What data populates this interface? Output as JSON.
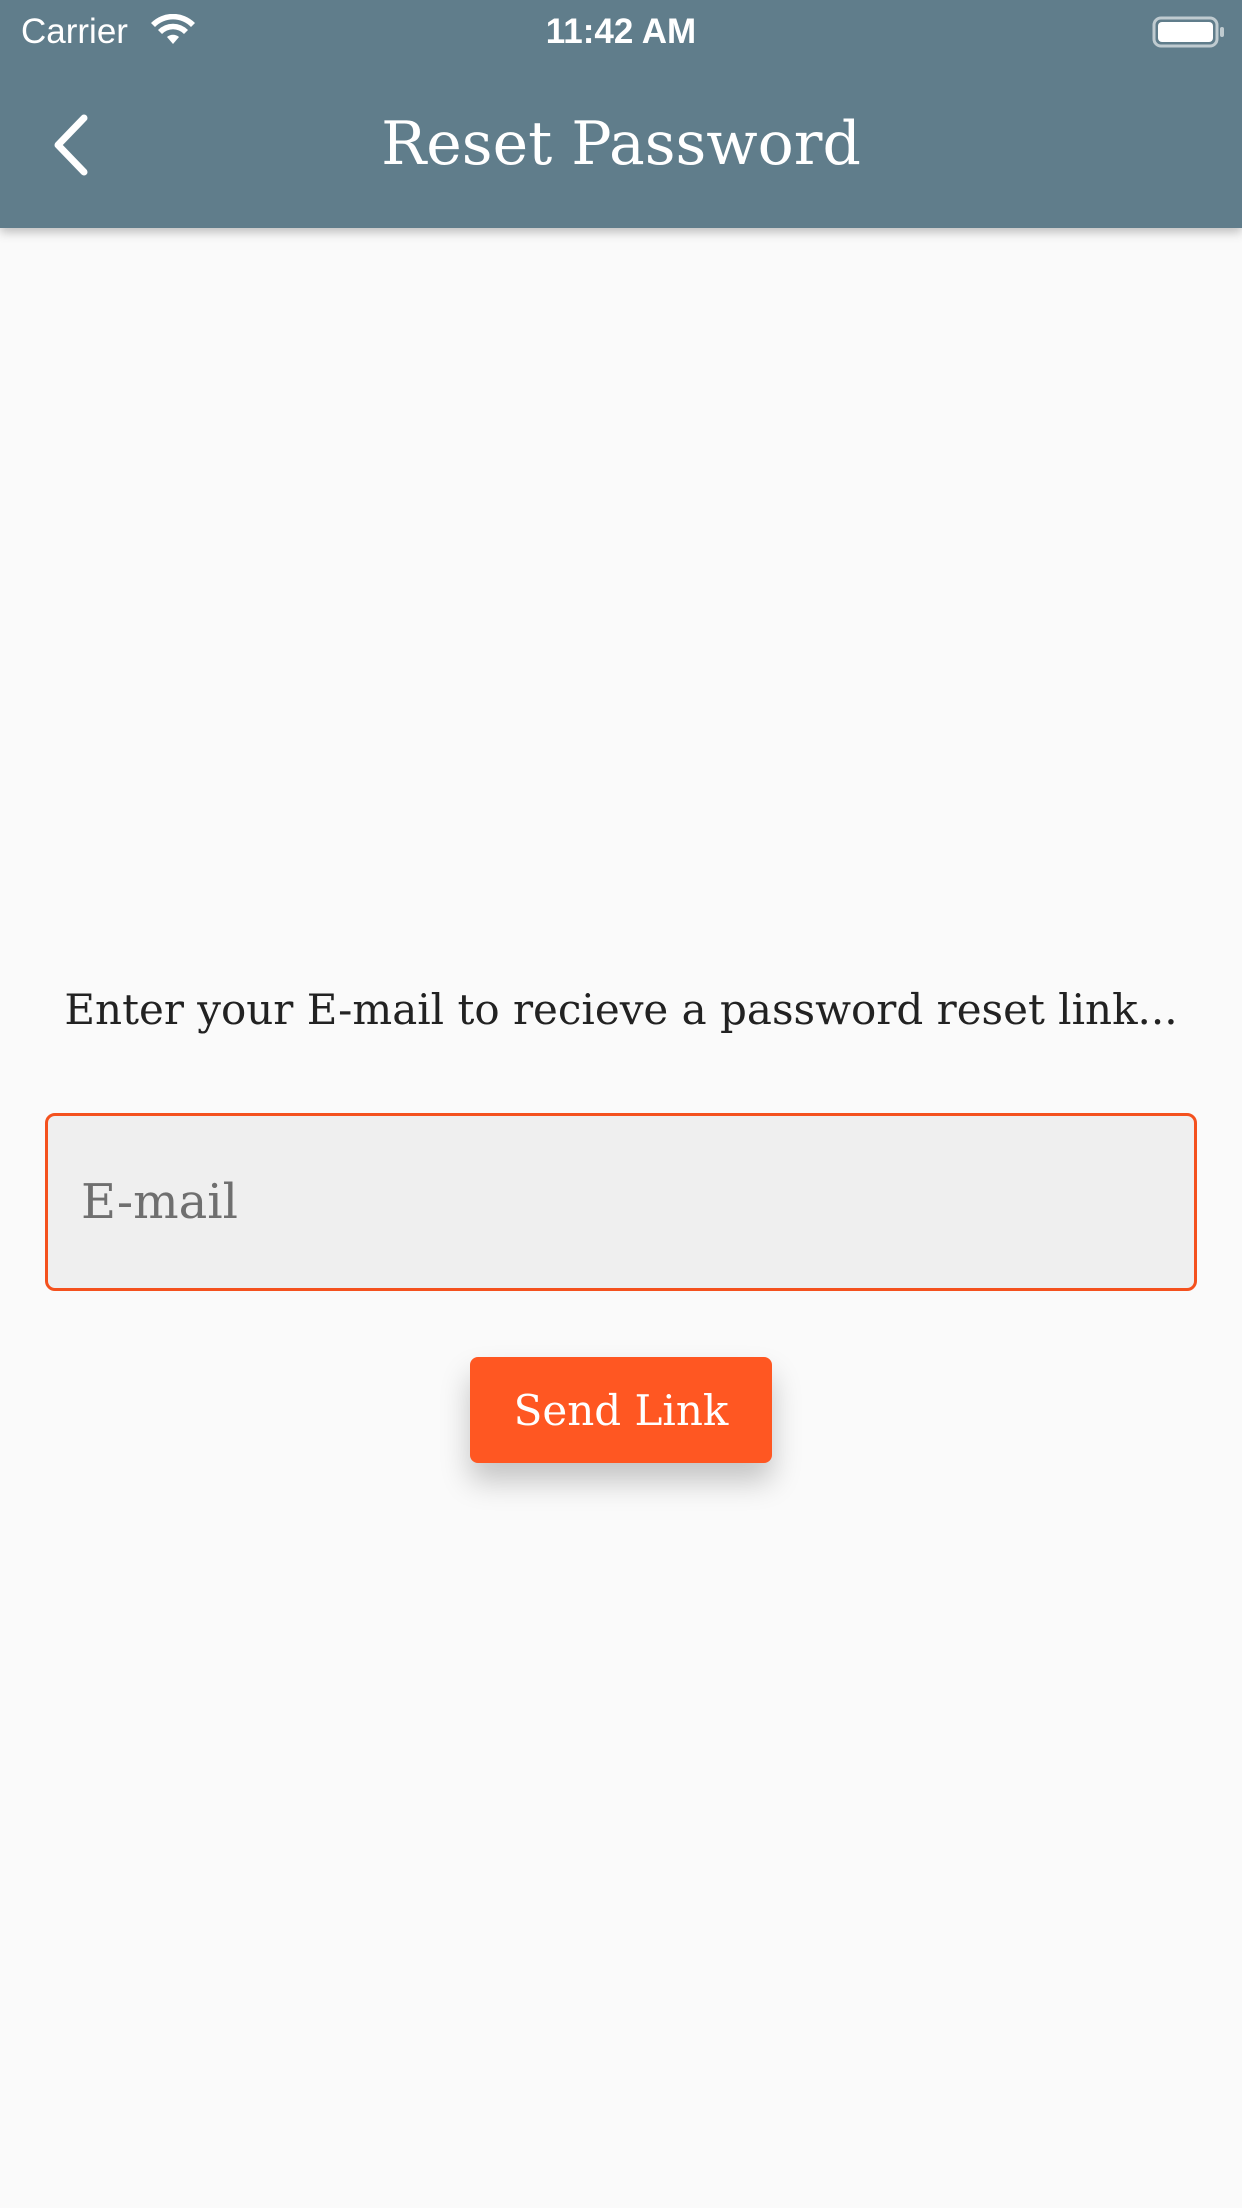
{
  "status_bar": {
    "carrier": "Carrier",
    "time": "11:42 AM",
    "wifi_icon": "wifi-icon",
    "battery_icon": "battery-icon"
  },
  "app_bar": {
    "title": "Reset Password",
    "back_icon": "chevron-left-icon",
    "background_color": "#607d8b"
  },
  "form": {
    "instruction": "Enter your E-mail to recieve a password reset link...",
    "email_placeholder": "E-mail",
    "email_value": "",
    "submit_label": "Send Link"
  },
  "colors": {
    "accent": "#ff5722",
    "field_border": "#f4511e",
    "field_background": "#efefef",
    "page_background": "#fafafa"
  }
}
